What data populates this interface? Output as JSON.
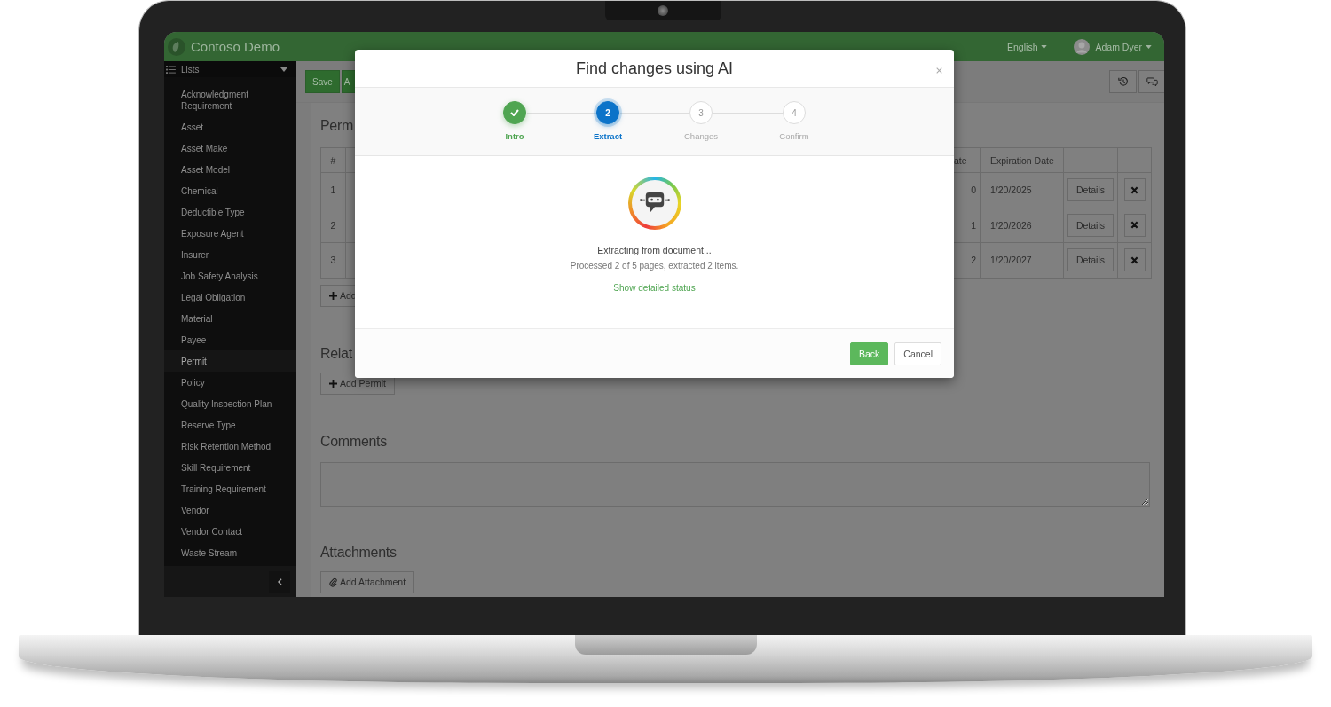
{
  "app": {
    "title": "Contoso Demo",
    "language": "English",
    "user": "Adam Dyer"
  },
  "sidebar": {
    "header": "Lists",
    "items": [
      {
        "label": "Acknowledgment Requirement",
        "selected": false
      },
      {
        "label": "Asset",
        "selected": false
      },
      {
        "label": "Asset Make",
        "selected": false
      },
      {
        "label": "Asset Model",
        "selected": false
      },
      {
        "label": "Chemical",
        "selected": false
      },
      {
        "label": "Deductible Type",
        "selected": false
      },
      {
        "label": "Exposure Agent",
        "selected": false
      },
      {
        "label": "Insurer",
        "selected": false
      },
      {
        "label": "Job Safety Analysis",
        "selected": false
      },
      {
        "label": "Legal Obligation",
        "selected": false
      },
      {
        "label": "Material",
        "selected": false
      },
      {
        "label": "Payee",
        "selected": false
      },
      {
        "label": "Permit",
        "selected": true
      },
      {
        "label": "Policy",
        "selected": false
      },
      {
        "label": "Quality Inspection Plan",
        "selected": false
      },
      {
        "label": "Reserve Type",
        "selected": false
      },
      {
        "label": "Risk Retention Method",
        "selected": false
      },
      {
        "label": "Skill Requirement",
        "selected": false
      },
      {
        "label": "Training Requirement",
        "selected": false
      },
      {
        "label": "Vendor",
        "selected": false
      },
      {
        "label": "Vendor Contact",
        "selected": false
      },
      {
        "label": "Waste Stream",
        "selected": false
      }
    ]
  },
  "toolbar": {
    "buttons": [
      "Save",
      "A"
    ]
  },
  "permits": {
    "heading": "Perm",
    "table": {
      "columns": [
        "#",
        "ate",
        "Expiration Date"
      ],
      "rows": [
        {
          "number": "1",
          "column_3": "0",
          "expiration": "1/20/2025",
          "action": "Details"
        },
        {
          "number": "2",
          "column_3": "1",
          "expiration": "1/20/2026",
          "action": "Details"
        },
        {
          "number": "3",
          "column_3": "2",
          "expiration": "1/20/2027",
          "action": "Details"
        }
      ]
    },
    "add_button": "Add"
  },
  "related": {
    "heading": "Relat",
    "add_button": "Add Permit"
  },
  "comments": {
    "heading": "Comments"
  },
  "attachments": {
    "heading": "Attachments",
    "add_button": "Add Attachment"
  },
  "modal": {
    "title": "Find changes using AI",
    "steps": [
      {
        "label": "Intro",
        "completed": true,
        "selected": false
      },
      {
        "number": "2",
        "label": "Extract",
        "completed": false,
        "selected": true
      },
      {
        "number": "3",
        "label": "Changes",
        "completed": false,
        "selected": false
      },
      {
        "number": "4",
        "label": "Confirm",
        "completed": false,
        "selected": false
      }
    ],
    "status": "Extracting from document...",
    "progress": "Processed 2 of 5 pages, extracted 2 items.",
    "link": "Show detailed status",
    "buttons": [
      {
        "label": "Back",
        "kind": "primary"
      },
      {
        "label": "Cancel",
        "kind": "default"
      }
    ]
  }
}
